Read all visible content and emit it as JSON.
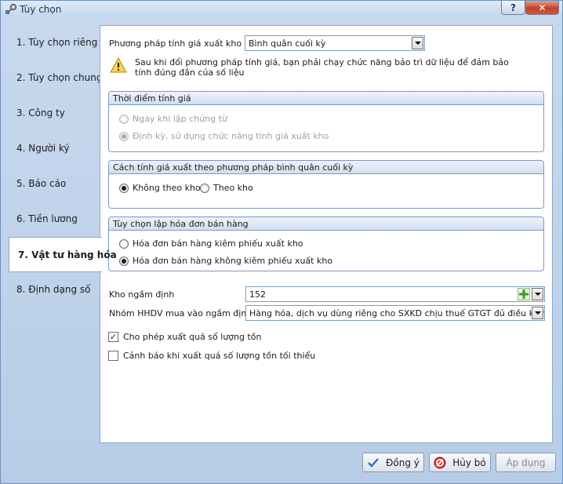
{
  "window": {
    "title": "Tùy chọn",
    "help_label": "?",
    "close_label": "✕"
  },
  "nav": {
    "items": [
      {
        "label": "1. Tùy chọn riêng"
      },
      {
        "label": "2. Tùy chọn chung"
      },
      {
        "label": "3. Công ty"
      },
      {
        "label": "4. Người ký"
      },
      {
        "label": "5. Báo cáo"
      },
      {
        "label": "6. Tiền lương"
      },
      {
        "label": "7. Vật tư hàng hóa"
      },
      {
        "label": "8. Định dạng số"
      }
    ],
    "active": "7. Vật tư hàng hóa"
  },
  "pricing_method": {
    "label": "Phương pháp tính giá xuất kho",
    "value": "Bình quân cuối kỳ",
    "warning": "Sau khi đổi phương pháp tính giá, bạn phải chạy chức năng bảo trì dữ liệu để đảm bảo tính đúng đắn của số liệu"
  },
  "timing_group": {
    "title": "Thời điểm tính giá",
    "options": [
      {
        "label": "Ngay khi lập chứng từ",
        "selected": false
      },
      {
        "label": "Định kỳ, sử dụng chức năng tính giá xuất kho",
        "selected": true
      }
    ]
  },
  "avg_method_group": {
    "title": "Cách tính giá xuất theo phương pháp bình quân cuối kỳ",
    "options": [
      {
        "label": "Không theo kho",
        "selected": true
      },
      {
        "label": "Theo kho",
        "selected": false
      }
    ]
  },
  "invoice_group": {
    "title": "Tùy chọn lập hóa đơn bán hàng",
    "options": [
      {
        "label": "Hóa đơn bán hàng kiêm phiếu xuất kho",
        "selected": false
      },
      {
        "label": "Hóa đơn bán hàng không kiêm phiếu xuất kho",
        "selected": true
      }
    ]
  },
  "default_warehouse": {
    "label": "Kho ngầm định",
    "value": "152"
  },
  "purchase_invoice_group": {
    "label": "Nhóm HHDV mua vào ngầm định",
    "value": "Hàng hóa, dịch vụ dùng riêng cho SXKD chịu thuế GTGT đủ điều kiện khấu"
  },
  "checkboxes": [
    {
      "label": "Cho phép xuất quá số lượng tồn",
      "checked": true
    },
    {
      "label": "Cảnh báo khi xuất quá số lượng tồn tối thiểu",
      "checked": false
    }
  ],
  "buttons": {
    "ok": "Đồng ý",
    "cancel": "Hủy bỏ",
    "apply": "Áp dụng"
  },
  "colors": {
    "window_bg": "#b7cde7",
    "border": "#7d99c2",
    "close_red": "#c4422a"
  }
}
